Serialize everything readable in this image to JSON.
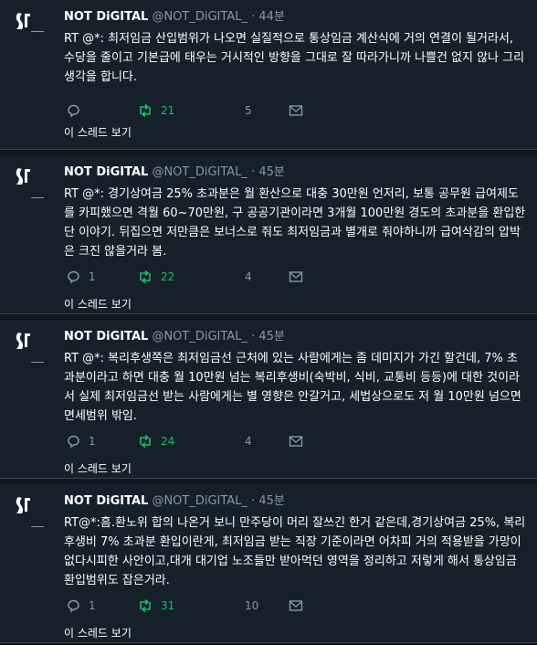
{
  "tweets": [
    {
      "name": "NOT DiGITAL",
      "handle": "@NOT_DiGITAL_",
      "sep": "·",
      "time": "44분",
      "text": "RT @*: 최저임금 산입범위가 나오면 실질적으로 통상임금 계산식에 거의 연결이 될거라서, 수당을 줄이고 기본급에 태우는 거시적인 방향을 그대로 잘 따라가니까 나쁠건 없지 않나 그리 생각을 합니다.",
      "replies": "",
      "retweets": "21",
      "likes": "5",
      "thread_link": "이 스레드 보기"
    },
    {
      "name": "NOT DiGITAL",
      "handle": "@NOT_DiGITAL_",
      "sep": "·",
      "time": "45분",
      "text": "RT @*: 경기상여금 25% 초과분은 월 환산으로 대충 30만원 언저리, 보통 공무원 급여제도를 카피했으면 격월 60~70만원, 구 공공기관이라면 3개월 100만원 경도의 초과분을 환입한단 이야기. 뒤집으면 저만큼은 보너스로 줘도 최저임금과 별개로 줘야하니까 급여삭감의 압박은 크진 않을거라 봄.",
      "replies": "1",
      "retweets": "22",
      "likes": "4",
      "thread_link": "이 스레드 보기"
    },
    {
      "name": "NOT DiGITAL",
      "handle": "@NOT_DiGITAL_",
      "sep": "·",
      "time": "45분",
      "text": "RT @*: 복리후생쪽은 최저임금선 근처에 있는 사람에게는 좀 데미지가 가긴 할건데, 7% 초과분이라고 하면 대충 월 10만원 넘는 복리후생비(숙박비, 식비, 교통비 등등)에 대한 것이라서 실제 최저임금선 받는 사람에게는 별 영향은 안갈거고, 세법상으로도 저 월 10만원 넘으면 면세범위 밖임.",
      "replies": "1",
      "retweets": "24",
      "likes": "4",
      "thread_link": "이 스레드 보기"
    },
    {
      "name": "NOT DiGITAL",
      "handle": "@NOT_DiGITAL_",
      "sep": "·",
      "time": "45분",
      "text": "RT@*:흠.환노위 합의 나온거 보니 만주당이 머리 잘쓰긴 한거 같은데,경기상여금 25%, 복리후생비 7% 초과분 환입이란게, 최저임금 받는 직장 기준이라면 어차피 거의 적용받을 가망이 없다시피한 사안이고,대개 대기업 노조들만 받아먹던 영역을 정리하고 저렇게 해서 통상임금 환입범위도 잡은거라.",
      "replies": "1",
      "retweets": "31",
      "likes": "10",
      "thread_link": "이 스레드 보기"
    }
  ],
  "colors": {
    "background": "#15202b",
    "text": "#ffffff",
    "muted": "#8899a6",
    "retweet_green": "#17bf63",
    "divider": "#38444d"
  },
  "icons": [
    "avatar-logo-icon",
    "reply-icon",
    "retweet-icon",
    "like-icon",
    "direct-message-icon"
  ]
}
